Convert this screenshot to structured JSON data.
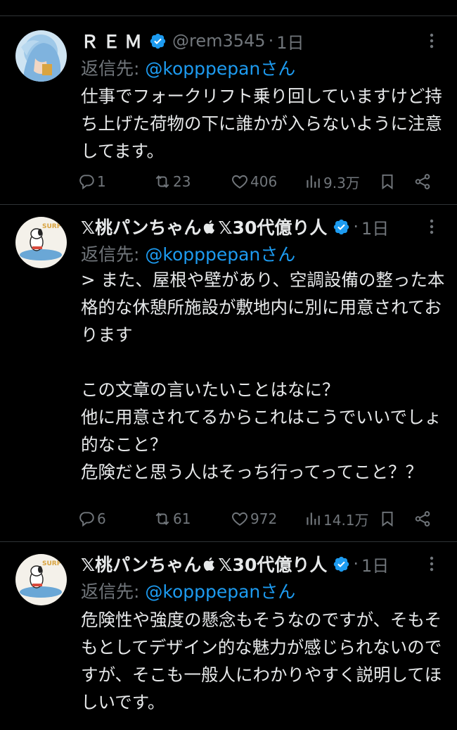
{
  "reply_prefix": "返信先: ",
  "reply_suffix": "さん",
  "colors": {
    "background": "#000000",
    "accent": "#1d9bf0",
    "muted": "#71767b",
    "text": "#e7e9ea",
    "divider": "#2f3336"
  },
  "tweets": [
    {
      "name": "ＲＥＭ",
      "handle": "@rem3545",
      "time": "1日",
      "reply_to": "@kopppepan",
      "body": "仕事でフォークリフト乗り回していますけど持ち上げた荷物の下に誰かが入らないように注意してます。",
      "stats": {
        "replies": "1",
        "retweets": "23",
        "likes": "406",
        "views": "9.3万"
      }
    },
    {
      "name": "𝕏桃パンちゃん",
      "name_suffix": "𝕏30代億り人",
      "handle": "",
      "time": "1日",
      "reply_to": "@kopppepan",
      "body": "> また、屋根や壁があり、空調設備の整った本格的な休憩所施設が敷地内に別に用意されております\n\nこの文章の言いたいことはなに？\n他に用意されてるからこれはこうでいいでしょ的なこと？\n危険だと思う人はそっち行ってってこと？？",
      "stats": {
        "replies": "6",
        "retweets": "61",
        "likes": "972",
        "views": "14.1万"
      }
    },
    {
      "name": "𝕏桃パンちゃん",
      "name_suffix": "𝕏30代億り人",
      "handle": "",
      "time": "1日",
      "reply_to": "@kopppepan",
      "body": "危険性や強度の懸念もそうなのですが、そもそもとしてデザイン的な魅力が感じられないのですが、そこも一般人にわかりやすく説明してほしいです。",
      "stats": {
        "replies": "",
        "retweets": "",
        "likes": "",
        "views": ""
      }
    }
  ]
}
